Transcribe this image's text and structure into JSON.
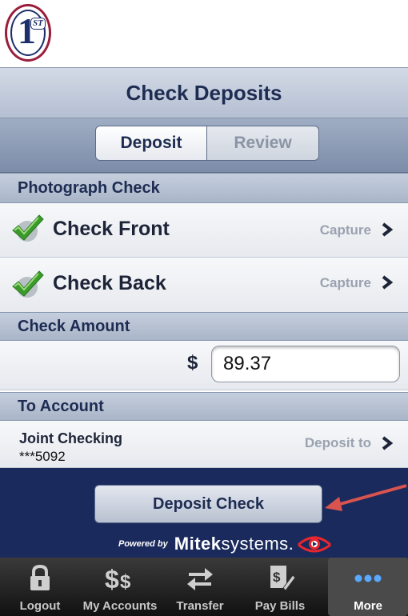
{
  "logo": {
    "text": "1",
    "superscript": "ST"
  },
  "header": {
    "title": "Check Deposits"
  },
  "segmented": {
    "deposit_label": "Deposit",
    "review_label": "Review",
    "selected": "Deposit"
  },
  "photograph": {
    "section_label": "Photograph Check",
    "front": {
      "label": "Check Front",
      "action": "Capture",
      "status_icon": "checkmark-icon"
    },
    "back": {
      "label": "Check Back",
      "action": "Capture",
      "status_icon": "checkmark-icon"
    }
  },
  "amount": {
    "section_label": "Check Amount",
    "currency_symbol": "$",
    "value": "89.37"
  },
  "to_account": {
    "section_label": "To Account",
    "account_name": "Joint Checking",
    "account_number": "***5092",
    "action": "Deposit to"
  },
  "action": {
    "deposit_button": "Deposit Check"
  },
  "powered": {
    "by": "Powered by",
    "brand_bold": "Mitek",
    "brand_rest": "systems",
    "brand_suffix": "."
  },
  "tabbar": {
    "tabs": [
      {
        "label": "Logout",
        "icon": "lock-icon"
      },
      {
        "label": "My Accounts",
        "icon": "dollar-signs-icon"
      },
      {
        "label": "Transfer",
        "icon": "transfer-arrows-icon"
      },
      {
        "label": "Pay Bills",
        "icon": "bill-pen-icon"
      },
      {
        "label": "More",
        "icon": "more-dots-icon",
        "selected": true
      }
    ]
  },
  "colors": {
    "navy": "#1a2a5c",
    "accent_red": "#d9534f",
    "check_green": "#3a9a2a"
  }
}
